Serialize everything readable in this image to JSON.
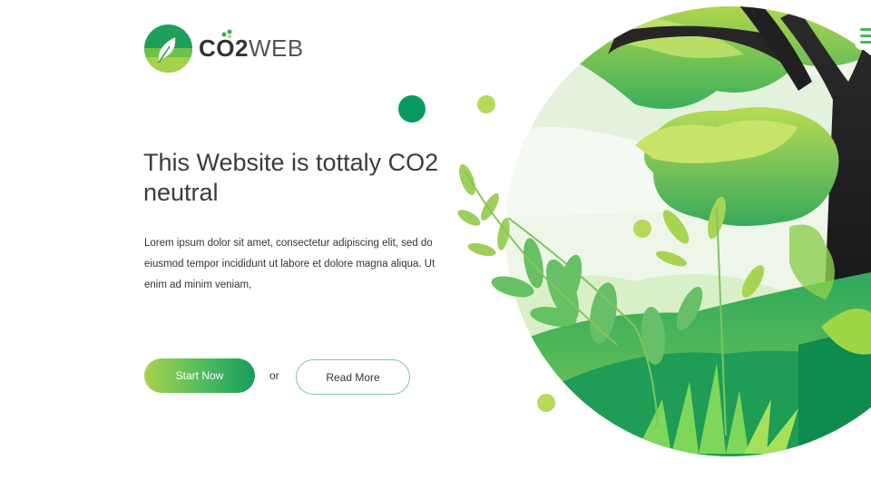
{
  "brand": {
    "name_bold": "CO2",
    "name_light": "WEB",
    "logo_icon": "leaf-icon"
  },
  "hero": {
    "title": "This Website is tottaly CO2 neutral",
    "text": "Lorem ipsum dolor sit amet, consectetur adipiscing elit, sed do eiusmod tempor incididunt ut labore et dolore magna aliqua. Ut enim ad minim veniam,"
  },
  "actions": {
    "start_label": "Start Now",
    "or_label": "or",
    "read_label": "Read More"
  },
  "nav": {
    "menu_icon": "hamburger-menu-icon"
  },
  "colors": {
    "primary_green": "#1a9b5d",
    "light_green": "#a9d24b",
    "dark_dot": "#079a5f",
    "lime_dot": "#b6d95a"
  }
}
